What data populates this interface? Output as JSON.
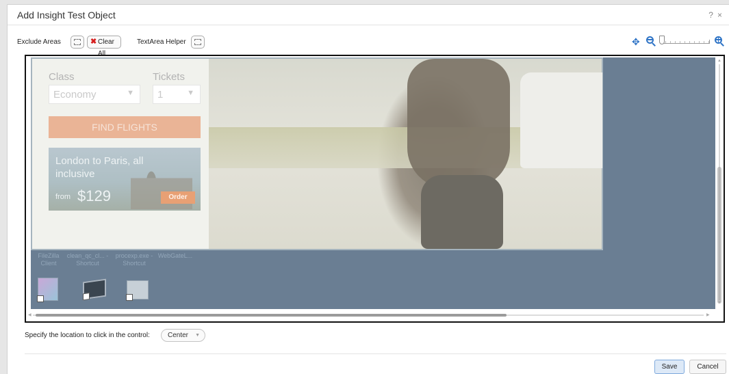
{
  "dialog": {
    "title": "Add Insight Test Object",
    "help_label": "?",
    "close_label": "×"
  },
  "toolbar": {
    "exclude_areas_label": "Exclude Areas",
    "clear_all_label": "Clear All",
    "clear_all_icon": "✖",
    "textarea_helper_label": "TextArea Helper",
    "move_icon": "✥",
    "zoom_level": 0.0
  },
  "captured_page": {
    "class_label": "Class",
    "tickets_label": "Tickets",
    "class_value": "Economy",
    "tickets_value": "1",
    "find_flights_label": "FIND FLIGHTS",
    "promo_title": "London to Paris, all inclusive",
    "promo_from": "from",
    "promo_price": "$129",
    "order_label": "Order"
  },
  "desktop_items": [
    {
      "label": "FileZilla Client"
    },
    {
      "label": "clean_qc_cl... - Shortcut"
    },
    {
      "label": "procexp.exe - Shortcut"
    },
    {
      "label": "WebGateL..."
    }
  ],
  "click_location": {
    "label": "Specify the location to click in the control:",
    "selected": "Center"
  },
  "footer": {
    "save_label": "Save",
    "cancel_label": "Cancel"
  }
}
